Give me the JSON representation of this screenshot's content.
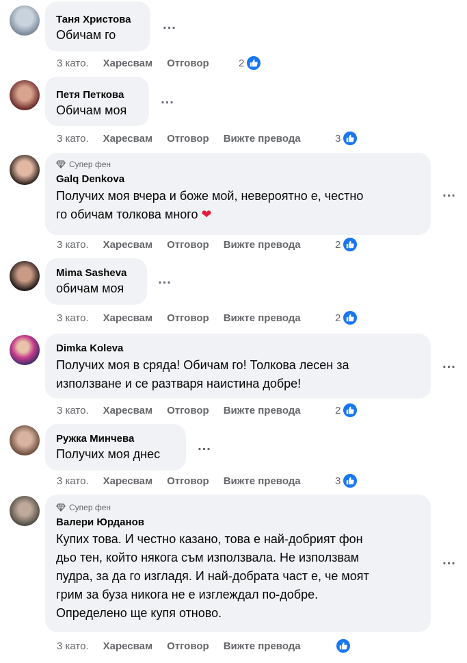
{
  "labels": {
    "time": "3 като.",
    "like": "Харесвам",
    "reply": "Отговор",
    "translate": "Вижте превода",
    "super_fan": "Супер фен",
    "more": "..."
  },
  "colors": {
    "bubble": "#f0f2f5",
    "like_blue": "#1877f2",
    "meta_gray": "#65676b",
    "heart": "#e41e3f"
  },
  "comments": [
    {
      "author": "Таня Христова",
      "text": "Обичам го",
      "reactions": "2",
      "icon": "like-icon"
    },
    {
      "author": "Петя Петкова",
      "text": "Обичам моя",
      "reactions": "3",
      "icon": "like-icon"
    },
    {
      "author": "Galq Denkova",
      "text_lines": [
        "Получих моя вчера и боже мой, невероятно е, честно",
        "го обичам толкова много"
      ],
      "emoji": "❤",
      "reactions": "2",
      "super_fan": true
    },
    {
      "author": "Mima Sasheva",
      "text": "обичам моя",
      "reactions": "2"
    },
    {
      "author": "Dimka Koleva",
      "text_lines": [
        "Получих моя в сряда! Обичам го! Толкова лесен за",
        "използване и се разтваря наистина добре!"
      ],
      "reactions": "2"
    },
    {
      "author": "Ружка Минчева",
      "text": "Получих моя днес",
      "reactions": "3"
    },
    {
      "author": "Валери Юрданов",
      "text_lines": [
        "Купих това. И честно казано, това е най-добрият фон",
        "дьо тен, който някога съм използвала. Не използвам",
        "пудра, за да го изгладя. И най-добрата част е, че моят",
        "грим за буза никога не е изглеждал по-добре.",
        "Определено ще купя отново."
      ],
      "reactions": "",
      "super_fan": true
    }
  ]
}
